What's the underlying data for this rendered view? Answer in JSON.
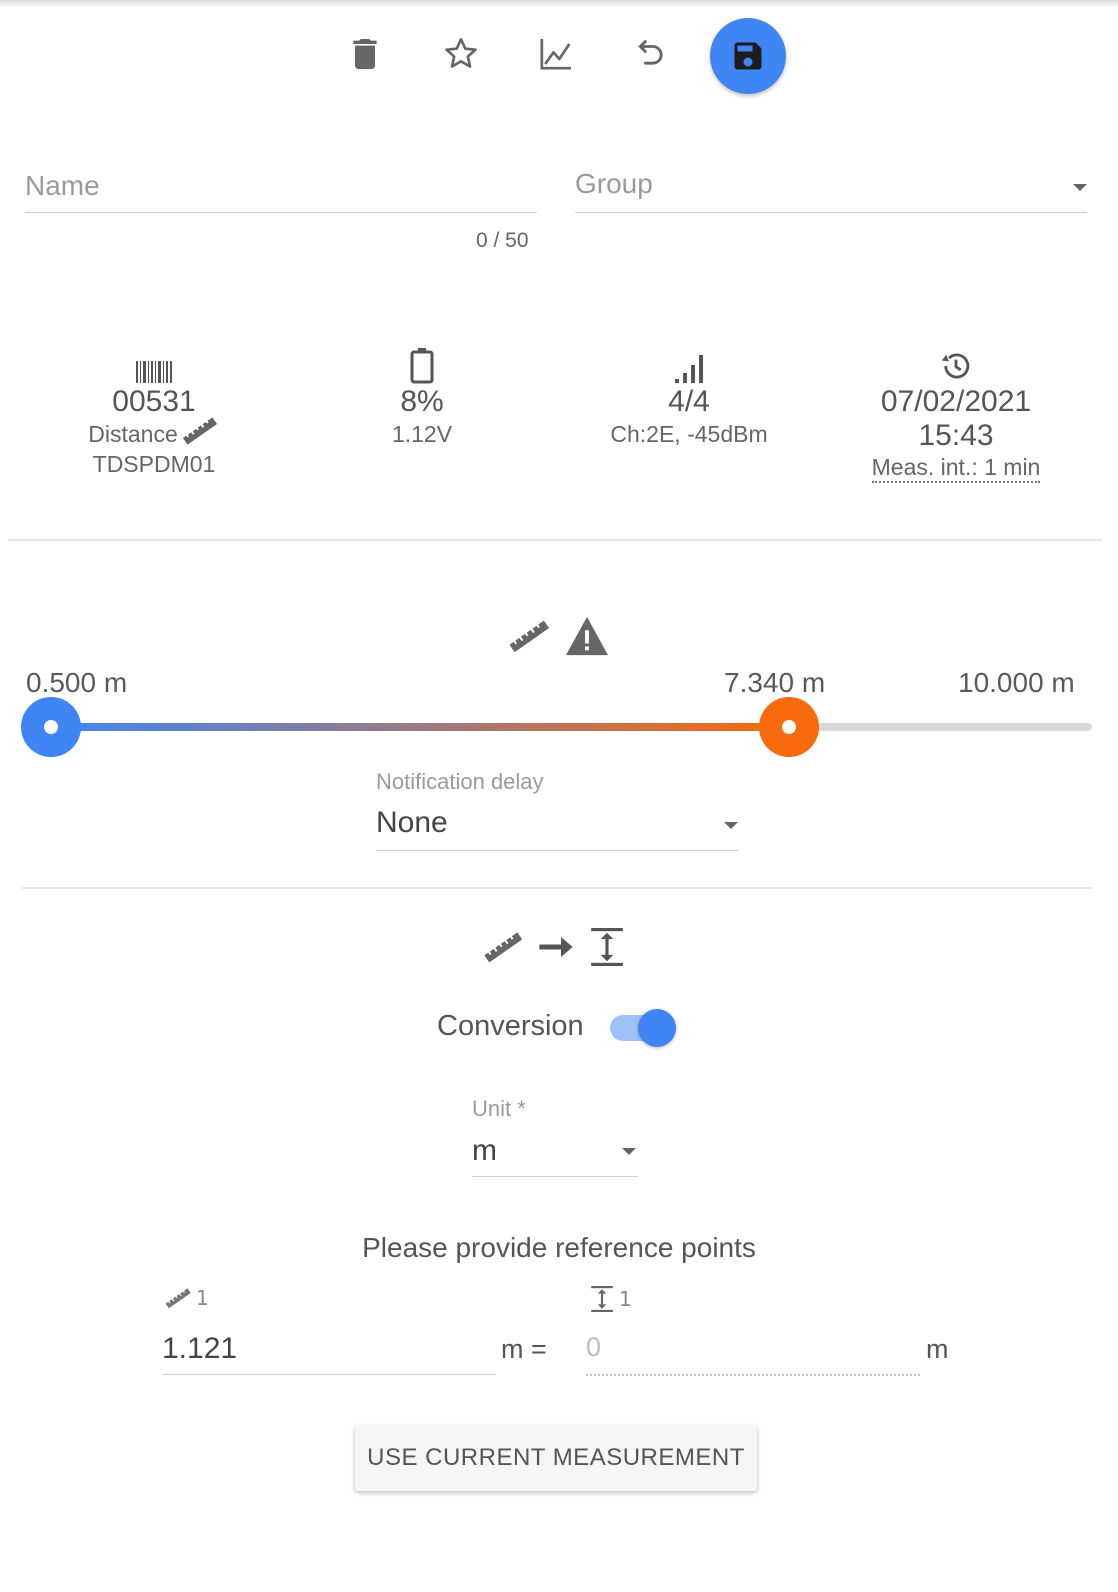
{
  "toolbar": {
    "icons": [
      "delete-icon",
      "star-icon",
      "chart-icon",
      "undo-icon",
      "save-icon"
    ],
    "accent": "#3f86f4"
  },
  "form": {
    "name_label": "Name",
    "name_counter": "0 / 50",
    "group_label": "Group"
  },
  "device": {
    "id": "00531",
    "type": "Distance",
    "model": "TDSPDM01",
    "battery_percent": "8%",
    "battery_voltage": "1.12V",
    "signal": "4/4",
    "channel": "Ch:2E, -45dBm",
    "date": "07/02/2021",
    "time": "15:43",
    "meas_interval": "Meas. int.: 1 min"
  },
  "threshold": {
    "min_label": "0.500 m",
    "value_label": "7.340 m",
    "max_label": "10.000 m",
    "min": 0.5,
    "value": 7.34,
    "max": 10.0,
    "low_color": "#3f86f4",
    "high_color": "#f76b0d",
    "notification_delay_label": "Notification delay",
    "notification_delay_value": "None"
  },
  "conversion": {
    "label": "Conversion",
    "enabled": true,
    "unit_label": "Unit *",
    "unit_value": "m",
    "reference_prompt": "Please provide reference points",
    "ref_distance_index": "1",
    "ref_level_index": "1",
    "ref_distance_value": "1.121",
    "ref_distance_unit": "m =",
    "ref_level_placeholder": "0",
    "ref_level_unit": "m",
    "use_current_button": "USE CURRENT MEASUREMENT"
  }
}
